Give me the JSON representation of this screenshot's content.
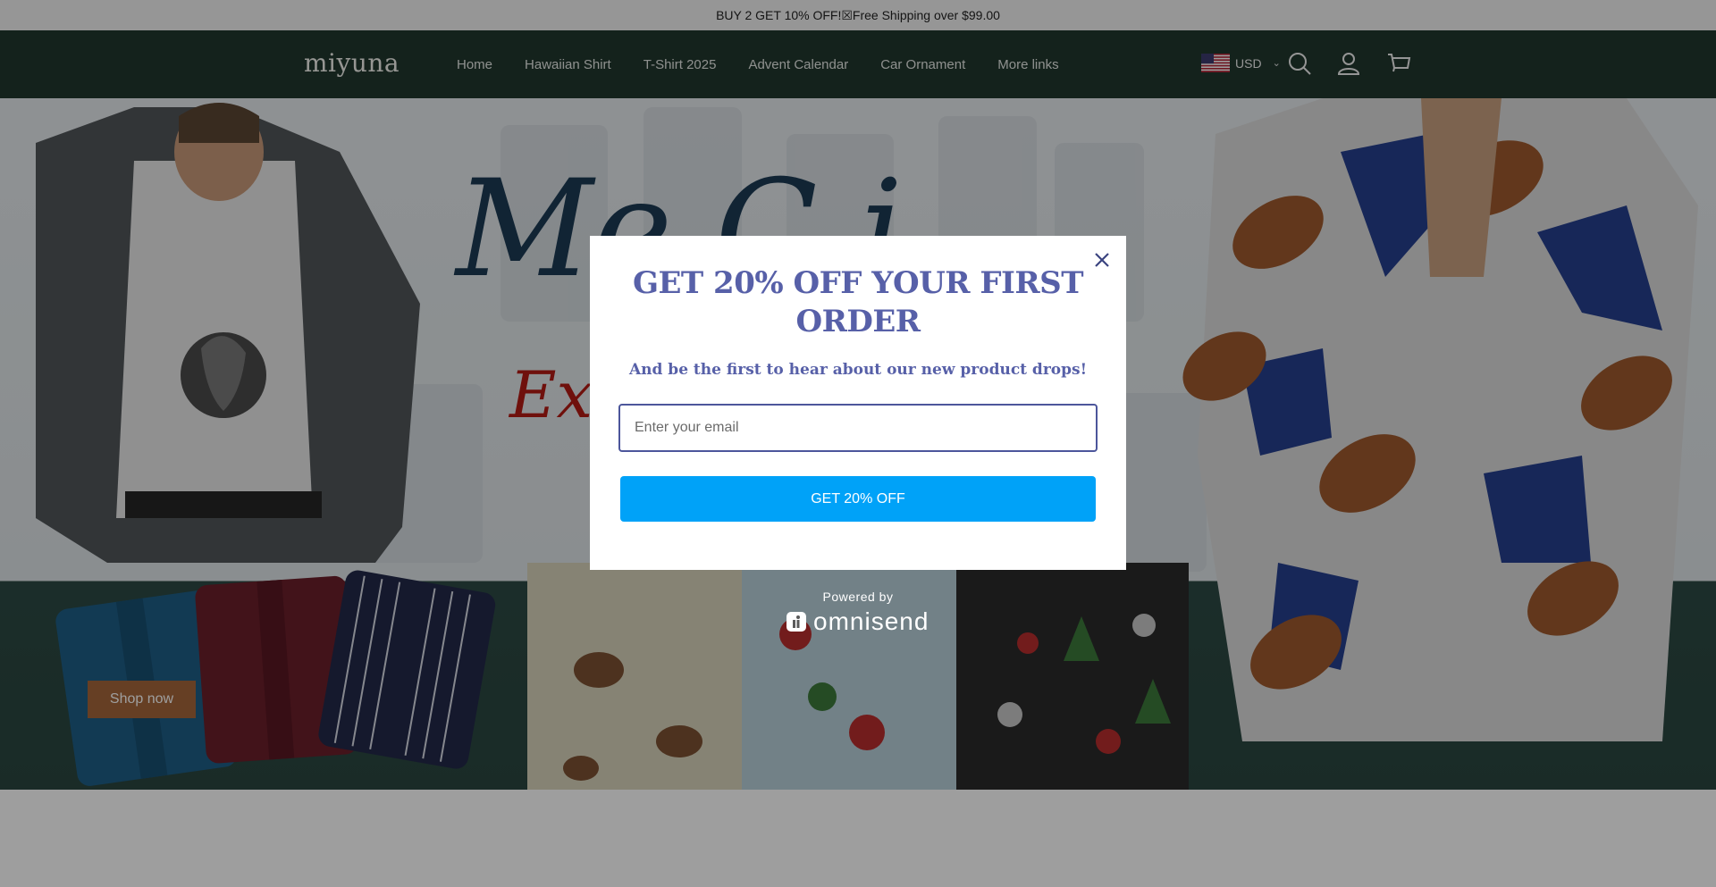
{
  "announcement": {
    "text": "BUY 2 GET 10% OFF!☒Free Shipping over $99.00"
  },
  "header": {
    "logo": "miyuna",
    "nav": [
      "Home",
      "Hawaiian Shirt",
      "T-Shirt 2025",
      "Advent Calendar",
      "Car Ornament",
      "More links"
    ],
    "currency": {
      "code": "USD",
      "flag": "us-flag-icon"
    },
    "icons": [
      "search-icon",
      "account-icon",
      "cart-icon"
    ]
  },
  "hero": {
    "title_partial": "Me  C  i  ",
    "subtitle_partial": "Exc                  n",
    "shop_button": "Shop now"
  },
  "popup": {
    "title": "GET 20% OFF YOUR FIRST ORDER",
    "subtitle": "And be the first to hear about our new product drops!",
    "email_placeholder": "Enter your email",
    "button": "GET 20% OFF",
    "powered_by": "Powered by",
    "brand": "omnisend",
    "close_icon": "close-icon"
  },
  "colors": {
    "header_bg": "#21382e",
    "popup_heading": "#5760a8",
    "cta_bg": "#00a2f8",
    "shop_button_bg": "#a5673a"
  }
}
